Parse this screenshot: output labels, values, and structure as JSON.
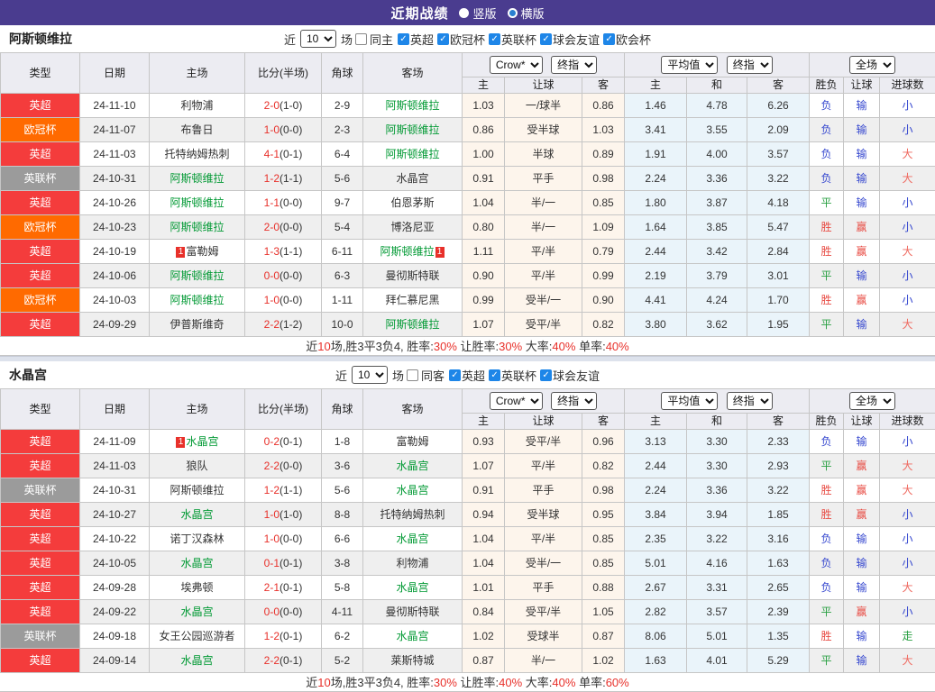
{
  "header": {
    "title": "近期战绩",
    "vertical_label": "竖版",
    "horizontal_label": "横版"
  },
  "selects": {
    "company": "Crow*",
    "final": "终指",
    "average": "平均值",
    "final2": "终指",
    "scope": "全场"
  },
  "table_labels": {
    "type": "类型",
    "date": "日期",
    "home": "主场",
    "score": "比分(半场)",
    "corner": "角球",
    "away": "客场",
    "host": "主",
    "handicap": "让球",
    "guest": "客",
    "avg_host": "主",
    "avg_draw": "和",
    "avg_guest": "客",
    "wdl": "胜负",
    "hcp_result": "让球",
    "goals": "进球数"
  },
  "colors": {
    "topbar": "#4a3c8f",
    "league": {
      "英超": "#f43c3c",
      "欧冠杯": "#ff6a00",
      "英联杯": "#9b9b9b"
    },
    "result": {
      "胜": "#e84c44",
      "赢": "#e84c44",
      "大": "#ef6a60",
      "平": "#2aa043",
      "走": "#2aa043",
      "负": "#3547cf",
      "输": "#3547cf",
      "小": "#3547cf"
    },
    "focal_team": "#009933",
    "score_red": "#e8302a",
    "odds_bg": "#fdf5ec",
    "avg_bg": "#eaf4fa"
  },
  "sections": [
    {
      "team": "阿斯顿维拉",
      "filters": {
        "near_label": "近",
        "count": "10",
        "games_label": "场",
        "same_label": "同主",
        "same_checked": false,
        "leagues": [
          "英超",
          "欧冠杯",
          "英联杯",
          "球会友谊",
          "欧会杯"
        ]
      },
      "rows": [
        {
          "league": "英超",
          "date": "24-11-10",
          "home": {
            "name": "利物浦"
          },
          "score": "2-0",
          "half": "1-0",
          "corners": "2-9",
          "away": {
            "name": "阿斯顿维拉",
            "focal": true
          },
          "odds": [
            "1.03",
            "一/球半",
            "0.86"
          ],
          "avg": [
            "1.46",
            "4.78",
            "6.26"
          ],
          "results": [
            "负",
            "输",
            "小"
          ]
        },
        {
          "league": "欧冠杯",
          "date": "24-11-07",
          "home": {
            "name": "布鲁日"
          },
          "score": "1-0",
          "half": "0-0",
          "corners": "2-3",
          "away": {
            "name": "阿斯顿维拉",
            "focal": true
          },
          "odds": [
            "0.86",
            "受半球",
            "1.03"
          ],
          "avg": [
            "3.41",
            "3.55",
            "2.09"
          ],
          "results": [
            "负",
            "输",
            "小"
          ]
        },
        {
          "league": "英超",
          "date": "24-11-03",
          "home": {
            "name": "托特纳姆热刺"
          },
          "score": "4-1",
          "half": "0-1",
          "corners": "6-4",
          "away": {
            "name": "阿斯顿维拉",
            "focal": true
          },
          "odds": [
            "1.00",
            "半球",
            "0.89"
          ],
          "avg": [
            "1.91",
            "4.00",
            "3.57"
          ],
          "results": [
            "负",
            "输",
            "大"
          ]
        },
        {
          "league": "英联杯",
          "date": "24-10-31",
          "home": {
            "name": "阿斯顿维拉",
            "focal": true
          },
          "score": "1-2",
          "half": "1-1",
          "corners": "5-6",
          "away": {
            "name": "水晶宫"
          },
          "odds": [
            "0.91",
            "平手",
            "0.98"
          ],
          "avg": [
            "2.24",
            "3.36",
            "3.22"
          ],
          "results": [
            "负",
            "输",
            "大"
          ]
        },
        {
          "league": "英超",
          "date": "24-10-26",
          "home": {
            "name": "阿斯顿维拉",
            "focal": true
          },
          "score": "1-1",
          "half": "0-0",
          "corners": "9-7",
          "away": {
            "name": "伯恩茅斯"
          },
          "odds": [
            "1.04",
            "半/一",
            "0.85"
          ],
          "avg": [
            "1.80",
            "3.87",
            "4.18"
          ],
          "results": [
            "平",
            "输",
            "小"
          ]
        },
        {
          "league": "欧冠杯",
          "date": "24-10-23",
          "home": {
            "name": "阿斯顿维拉",
            "focal": true
          },
          "score": "2-0",
          "half": "0-0",
          "corners": "5-4",
          "away": {
            "name": "博洛尼亚"
          },
          "odds": [
            "0.80",
            "半/一",
            "1.09"
          ],
          "avg": [
            "1.64",
            "3.85",
            "5.47"
          ],
          "results": [
            "胜",
            "赢",
            "小"
          ]
        },
        {
          "league": "英超",
          "date": "24-10-19",
          "home": {
            "badge": "1",
            "name": "富勒姆"
          },
          "score": "1-3",
          "half": "1-1",
          "corners": "6-11",
          "away": {
            "name": "阿斯顿维拉",
            "focal": true,
            "badge2": "1"
          },
          "odds": [
            "1.11",
            "平/半",
            "0.79"
          ],
          "avg": [
            "2.44",
            "3.42",
            "2.84"
          ],
          "results": [
            "胜",
            "赢",
            "大"
          ]
        },
        {
          "league": "英超",
          "date": "24-10-06",
          "home": {
            "name": "阿斯顿维拉",
            "focal": true
          },
          "score": "0-0",
          "half": "0-0",
          "corners": "6-3",
          "away": {
            "name": "曼彻斯特联"
          },
          "odds": [
            "0.90",
            "平/半",
            "0.99"
          ],
          "avg": [
            "2.19",
            "3.79",
            "3.01"
          ],
          "results": [
            "平",
            "输",
            "小"
          ]
        },
        {
          "league": "欧冠杯",
          "date": "24-10-03",
          "home": {
            "name": "阿斯顿维拉",
            "focal": true
          },
          "score": "1-0",
          "half": "0-0",
          "corners": "1-11",
          "away": {
            "name": "拜仁慕尼黑"
          },
          "odds": [
            "0.99",
            "受半/一",
            "0.90"
          ],
          "avg": [
            "4.41",
            "4.24",
            "1.70"
          ],
          "results": [
            "胜",
            "赢",
            "小"
          ]
        },
        {
          "league": "英超",
          "date": "24-09-29",
          "home": {
            "name": "伊普斯维奇"
          },
          "score": "2-2",
          "half": "1-2",
          "corners": "10-0",
          "away": {
            "name": "阿斯顿维拉",
            "focal": true
          },
          "odds": [
            "1.07",
            "受平/半",
            "0.82"
          ],
          "avg": [
            "3.80",
            "3.62",
            "1.95"
          ],
          "results": [
            "平",
            "输",
            "大"
          ]
        }
      ],
      "summary": [
        {
          "t": "近"
        },
        {
          "t": "10",
          "r": true
        },
        {
          "t": "场,胜3平3负4, 胜率:"
        },
        {
          "t": "30%",
          "r": true
        },
        {
          "t": " 让胜率:"
        },
        {
          "t": "30%",
          "r": true
        },
        {
          "t": " 大率:"
        },
        {
          "t": "40%",
          "r": true
        },
        {
          "t": " 单率:"
        },
        {
          "t": "40%",
          "r": true
        }
      ]
    },
    {
      "team": "水晶宫",
      "filters": {
        "near_label": "近",
        "count": "10",
        "games_label": "场",
        "same_label": "同客",
        "same_checked": false,
        "leagues": [
          "英超",
          "英联杯",
          "球会友谊"
        ]
      },
      "rows": [
        {
          "league": "英超",
          "date": "24-11-09",
          "home": {
            "badge": "1",
            "name": "水晶宫",
            "focal": true
          },
          "score": "0-2",
          "half": "0-1",
          "corners": "1-8",
          "away": {
            "name": "富勒姆"
          },
          "odds": [
            "0.93",
            "受平/半",
            "0.96"
          ],
          "avg": [
            "3.13",
            "3.30",
            "2.33"
          ],
          "results": [
            "负",
            "输",
            "小"
          ]
        },
        {
          "league": "英超",
          "date": "24-11-03",
          "home": {
            "name": "狼队"
          },
          "score": "2-2",
          "half": "0-0",
          "corners": "3-6",
          "away": {
            "name": "水晶宫",
            "focal": true
          },
          "odds": [
            "1.07",
            "平/半",
            "0.82"
          ],
          "avg": [
            "2.44",
            "3.30",
            "2.93"
          ],
          "results": [
            "平",
            "赢",
            "大"
          ]
        },
        {
          "league": "英联杯",
          "date": "24-10-31",
          "home": {
            "name": "阿斯顿维拉"
          },
          "score": "1-2",
          "half": "1-1",
          "corners": "5-6",
          "away": {
            "name": "水晶宫",
            "focal": true
          },
          "odds": [
            "0.91",
            "平手",
            "0.98"
          ],
          "avg": [
            "2.24",
            "3.36",
            "3.22"
          ],
          "results": [
            "胜",
            "赢",
            "大"
          ]
        },
        {
          "league": "英超",
          "date": "24-10-27",
          "home": {
            "name": "水晶宫",
            "focal": true
          },
          "score": "1-0",
          "half": "1-0",
          "corners": "8-8",
          "away": {
            "name": "托特纳姆热刺"
          },
          "odds": [
            "0.94",
            "受半球",
            "0.95"
          ],
          "avg": [
            "3.84",
            "3.94",
            "1.85"
          ],
          "results": [
            "胜",
            "赢",
            "小"
          ]
        },
        {
          "league": "英超",
          "date": "24-10-22",
          "home": {
            "name": "诺丁汉森林"
          },
          "score": "1-0",
          "half": "0-0",
          "corners": "6-6",
          "away": {
            "name": "水晶宫",
            "focal": true
          },
          "odds": [
            "1.04",
            "平/半",
            "0.85"
          ],
          "avg": [
            "2.35",
            "3.22",
            "3.16"
          ],
          "results": [
            "负",
            "输",
            "小"
          ]
        },
        {
          "league": "英超",
          "date": "24-10-05",
          "home": {
            "name": "水晶宫",
            "focal": true
          },
          "score": "0-1",
          "half": "0-1",
          "corners": "3-8",
          "away": {
            "name": "利物浦"
          },
          "odds": [
            "1.04",
            "受半/一",
            "0.85"
          ],
          "avg": [
            "5.01",
            "4.16",
            "1.63"
          ],
          "results": [
            "负",
            "输",
            "小"
          ]
        },
        {
          "league": "英超",
          "date": "24-09-28",
          "home": {
            "name": "埃弗顿"
          },
          "score": "2-1",
          "half": "0-1",
          "corners": "5-8",
          "away": {
            "name": "水晶宫",
            "focal": true
          },
          "odds": [
            "1.01",
            "平手",
            "0.88"
          ],
          "avg": [
            "2.67",
            "3.31",
            "2.65"
          ],
          "results": [
            "负",
            "输",
            "大"
          ]
        },
        {
          "league": "英超",
          "date": "24-09-22",
          "home": {
            "name": "水晶宫",
            "focal": true
          },
          "score": "0-0",
          "half": "0-0",
          "corners": "4-11",
          "away": {
            "name": "曼彻斯特联"
          },
          "odds": [
            "0.84",
            "受平/半",
            "1.05"
          ],
          "avg": [
            "2.82",
            "3.57",
            "2.39"
          ],
          "results": [
            "平",
            "赢",
            "小"
          ]
        },
        {
          "league": "英联杯",
          "date": "24-09-18",
          "home": {
            "name": "女王公园巡游者"
          },
          "score": "1-2",
          "half": "0-1",
          "corners": "6-2",
          "away": {
            "name": "水晶宫",
            "focal": true
          },
          "odds": [
            "1.02",
            "受球半",
            "0.87"
          ],
          "avg": [
            "8.06",
            "5.01",
            "1.35"
          ],
          "results": [
            "胜",
            "输",
            "走"
          ]
        },
        {
          "league": "英超",
          "date": "24-09-14",
          "home": {
            "name": "水晶宫",
            "focal": true
          },
          "score": "2-2",
          "half": "0-1",
          "corners": "5-2",
          "away": {
            "name": "莱斯特城"
          },
          "odds": [
            "0.87",
            "半/一",
            "1.02"
          ],
          "avg": [
            "1.63",
            "4.01",
            "5.29"
          ],
          "results": [
            "平",
            "输",
            "大"
          ]
        }
      ],
      "summary": [
        {
          "t": "近"
        },
        {
          "t": "10",
          "r": true
        },
        {
          "t": "场,胜3平3负4, 胜率:"
        },
        {
          "t": "30%",
          "r": true
        },
        {
          "t": " 让胜率:"
        },
        {
          "t": "40%",
          "r": true
        },
        {
          "t": " 大率:"
        },
        {
          "t": "40%",
          "r": true
        },
        {
          "t": " 单率:"
        },
        {
          "t": "60%",
          "r": true
        }
      ]
    }
  ]
}
